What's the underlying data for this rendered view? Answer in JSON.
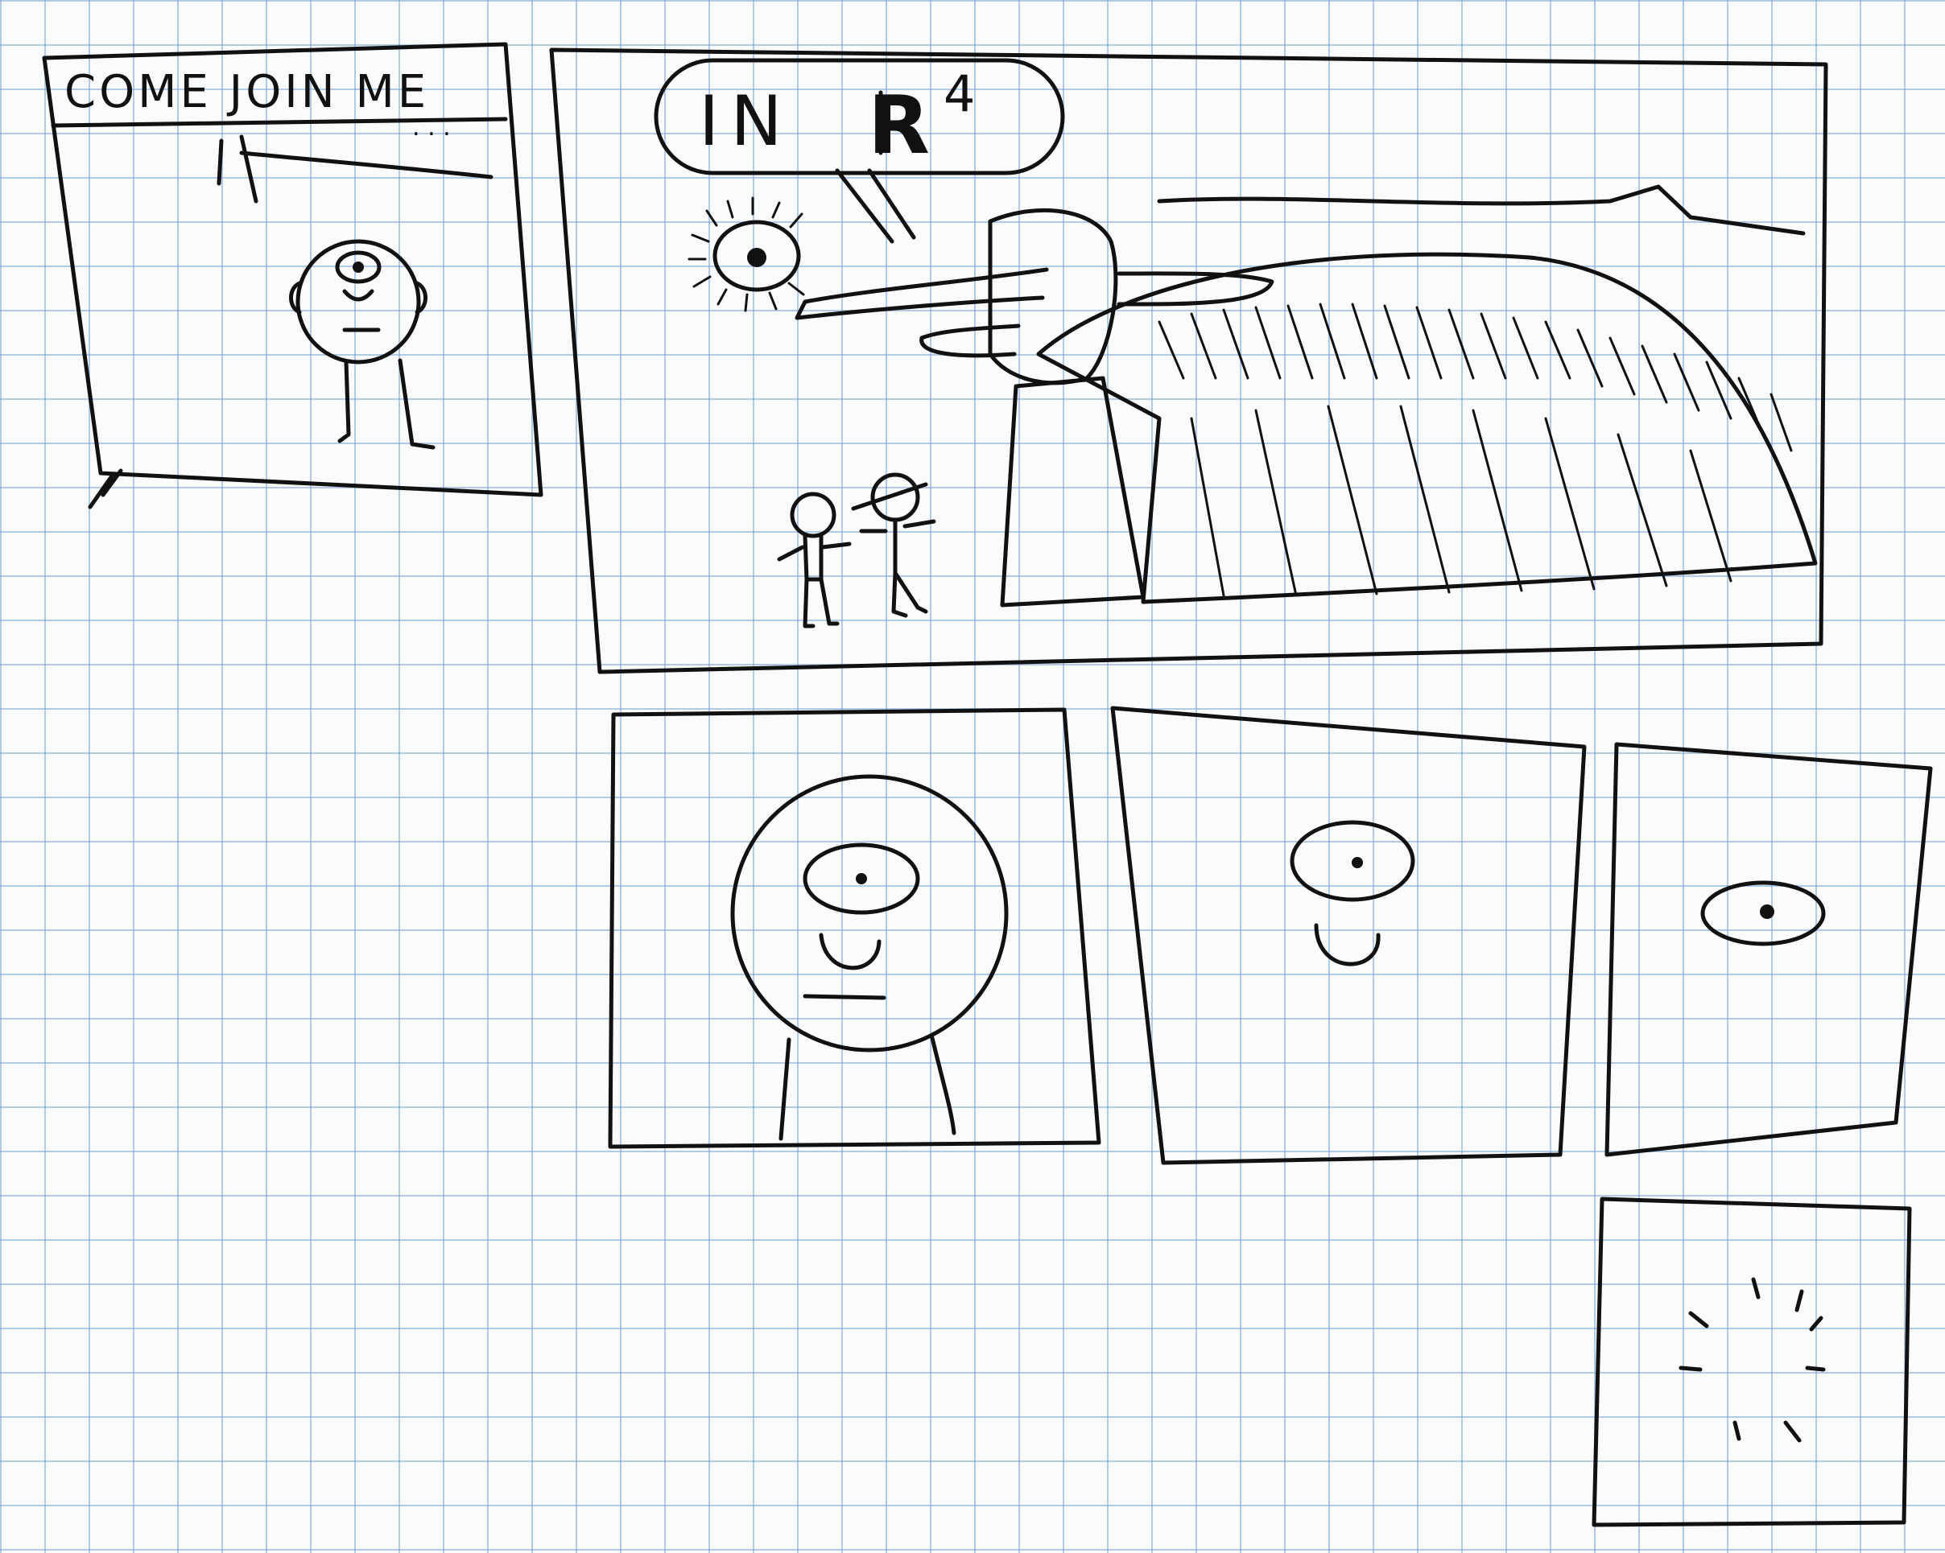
{
  "panel1": {
    "caption": "COME JOIN ME",
    "trailing_dots": ". . ."
  },
  "panel2": {
    "speech": "IN",
    "space_symbol": "R",
    "exponent": "4"
  }
}
